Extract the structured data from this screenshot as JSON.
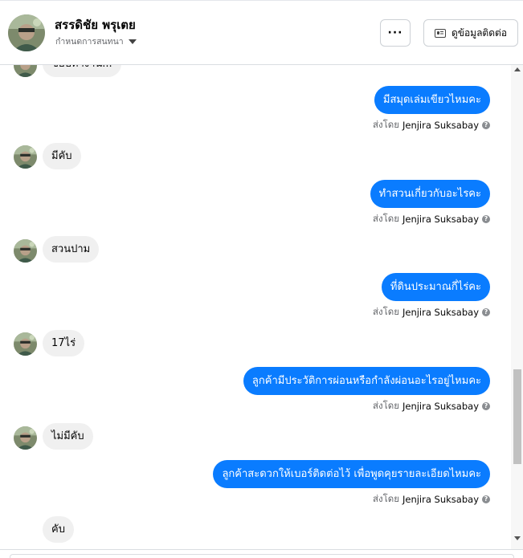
{
  "header": {
    "name": "สรรดิชัย พรุเตย",
    "subtitle": "กำหนดการสนทนา",
    "more_label": "···",
    "contact_label": "ดูข้อมูลติดต่อ"
  },
  "chat": {
    "partial_top": "ชอบทางาน...",
    "sent_by_prefix": "ส่งโดย",
    "agent": "Jenjira Suksabay",
    "messages": [
      {
        "dir": "out",
        "text": "มีสมุดเล่มเขียวไหมคะ"
      },
      {
        "dir": "in",
        "text": "มีคับ"
      },
      {
        "dir": "out",
        "text": "ทำสวนเกี่ยวกับอะไรคะ"
      },
      {
        "dir": "in",
        "text": "สวนปาม"
      },
      {
        "dir": "out",
        "text": "ที่ดินประมาณกี่ไร่คะ"
      },
      {
        "dir": "in",
        "text": "17ไร่"
      },
      {
        "dir": "out",
        "text": "ลูกค้ามีประวัติการผ่อนหรือกำลังผ่อนอะไรอยู่ไหมคะ"
      },
      {
        "dir": "in",
        "text": "ไม่มีคับ"
      },
      {
        "dir": "out",
        "text": "ลูกค้าสะดวกให้เบอร์ติดต่อไว้ เพื่อพูดคุยรายละเอียดไหมคะ"
      },
      {
        "dir": "in",
        "text": "คับ"
      }
    ]
  },
  "colors": {
    "outgoing_bubble": "#0a7cff",
    "incoming_bubble": "#f0f0f0",
    "muted_text": "#65676b"
  },
  "icons": [
    "avatar",
    "caret-down-icon",
    "more-icon",
    "contact-card-icon",
    "help-icon"
  ]
}
